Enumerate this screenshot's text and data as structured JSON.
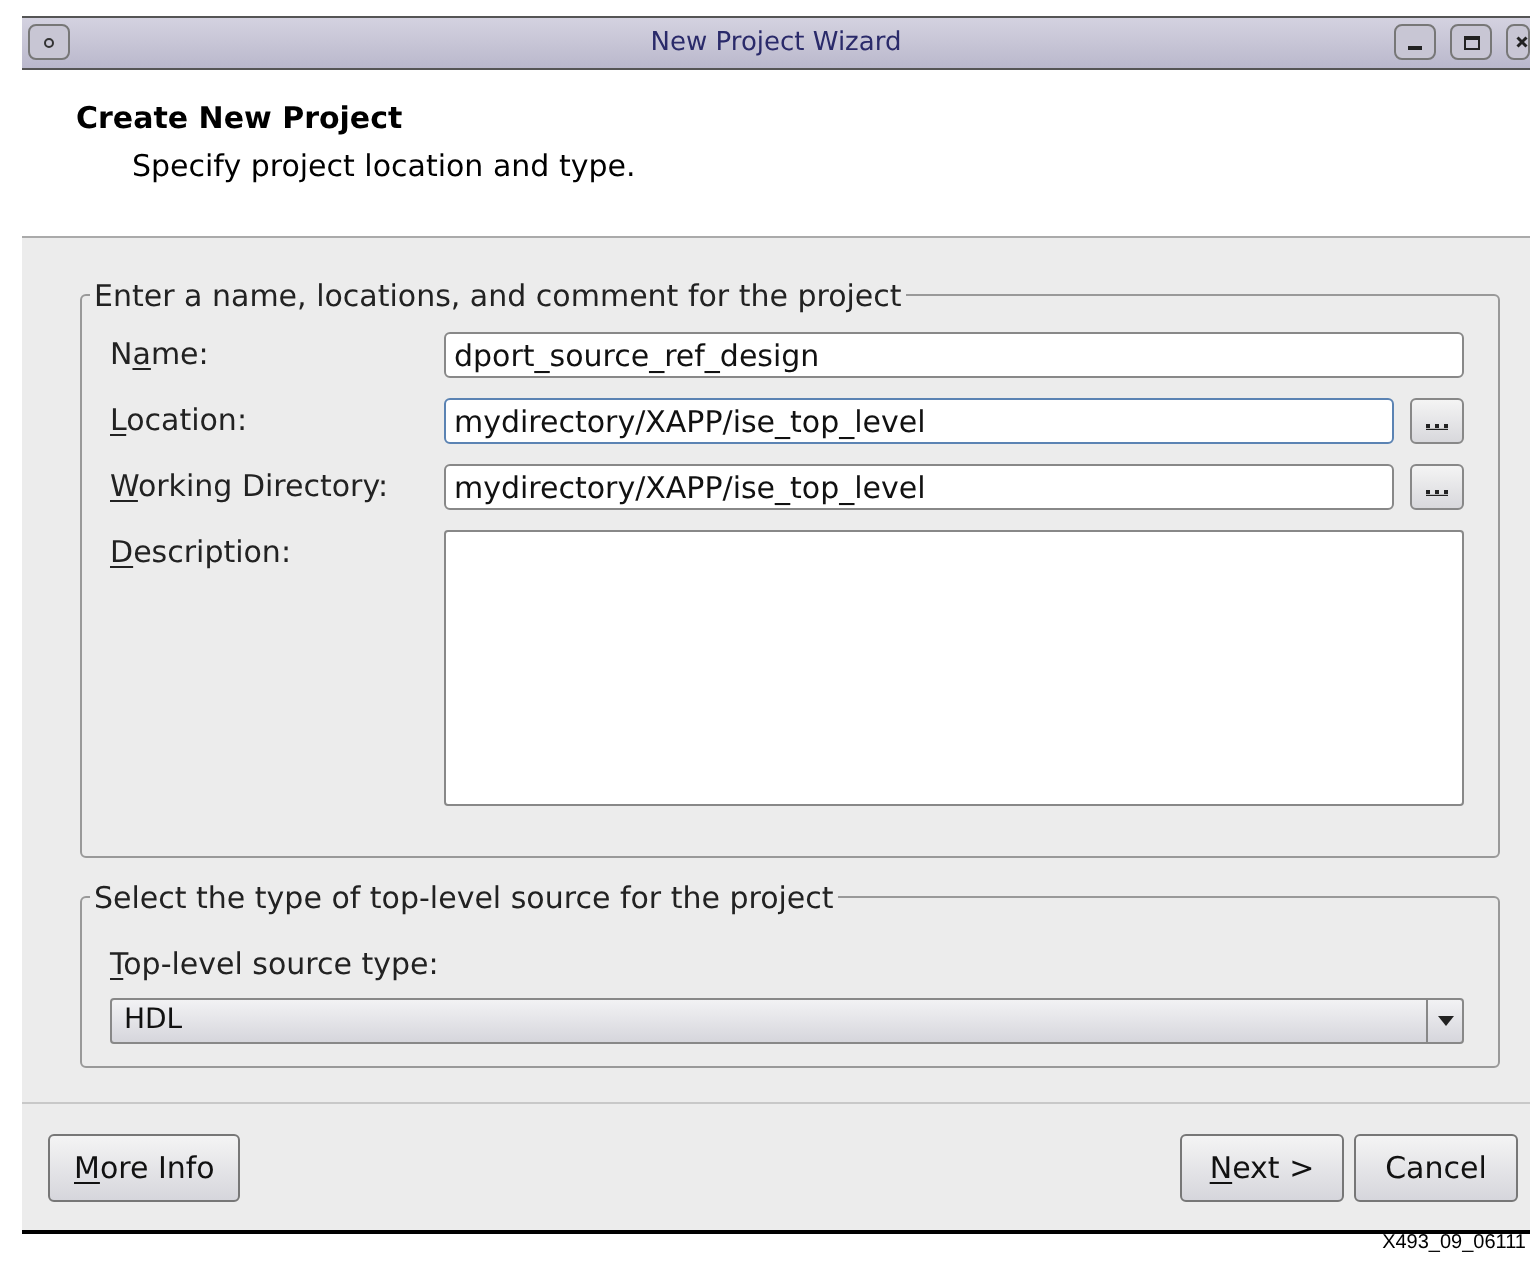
{
  "window": {
    "title": "New Project Wizard"
  },
  "header": {
    "title": "Create New Project",
    "subtitle": "Specify project location and type."
  },
  "project_group": {
    "legend": "Enter a name, locations, and comment for the project",
    "fields": [
      {
        "kind": "text",
        "label": {
          "pre": "N",
          "key": "a",
          "post": "me:"
        },
        "value": "dport_source_ref_design",
        "focused": false
      },
      {
        "kind": "browse",
        "label": {
          "key": "L",
          "post": "ocation:"
        },
        "value": "mydirectory/XAPP/ise_top_level",
        "focused": true
      },
      {
        "kind": "browse",
        "label": {
          "key": "W",
          "post": "orking Directory:"
        },
        "value": "mydirectory/XAPP/ise_top_level",
        "focused": false
      },
      {
        "kind": "textarea",
        "label": {
          "key": "D",
          "post": "escription:"
        },
        "focused": false
      }
    ]
  },
  "source_group": {
    "legend": "Select the type of top-level source for the project",
    "label": {
      "key": "T",
      "post": "op-level source type:"
    },
    "value": "HDL"
  },
  "left_buttons": [
    {
      "label": {
        "key": "M",
        "post": "ore Info"
      }
    }
  ],
  "right_buttons": [
    {
      "label": {
        "key": "N",
        "post": "ext >"
      }
    },
    {
      "label": {
        "pre": "Cancel"
      }
    }
  ],
  "caption": "X493_09_06111"
}
